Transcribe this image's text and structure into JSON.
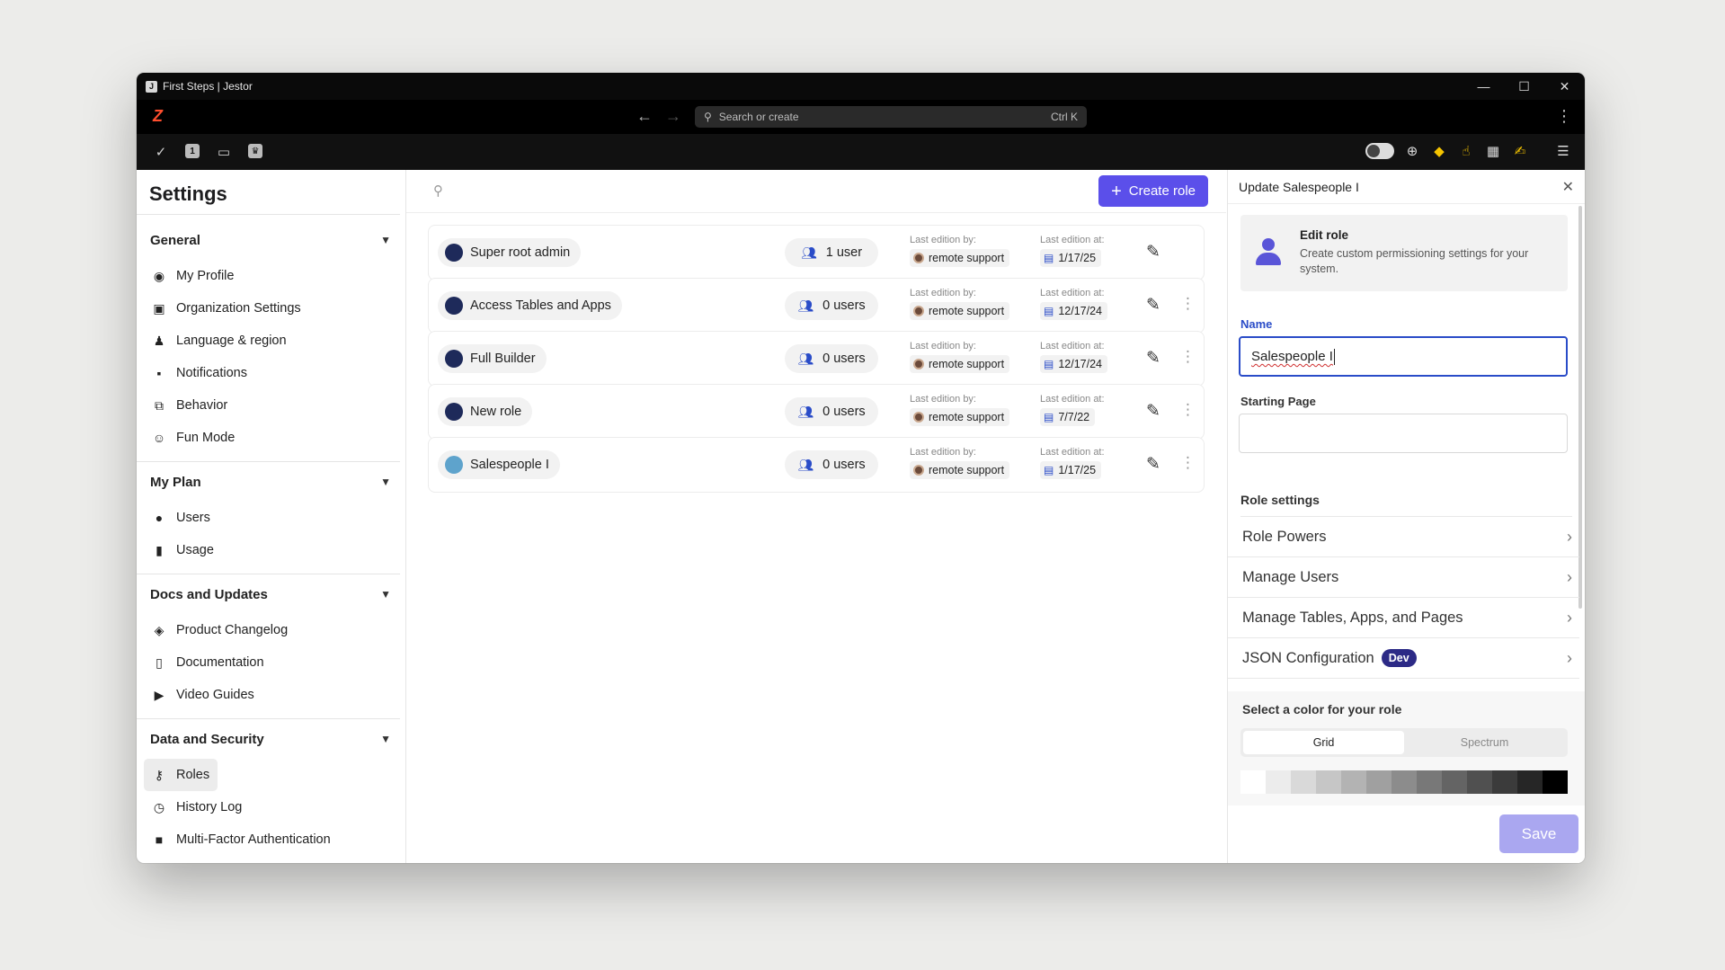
{
  "window": {
    "title": "First Steps | Jestor",
    "minimize": "—",
    "maximize": "☐",
    "close": "✕"
  },
  "navbar": {
    "logo": "Z",
    "back": "←",
    "forward": "→",
    "search_placeholder": "Search or create",
    "shortcut": "Ctrl K",
    "menu": "⋮"
  },
  "toolbar": {
    "left_icons": [
      "check-circle-icon",
      "number-icon",
      "chat-icon",
      "crown-icon"
    ],
    "badge_number": "1"
  },
  "sidebar": {
    "title": "Settings",
    "sections": [
      {
        "label": "General",
        "items": [
          {
            "label": "My Profile",
            "icon": "user-circle-icon",
            "glyph": "◉"
          },
          {
            "label": "Organization Settings",
            "icon": "id-card-icon",
            "glyph": "▣"
          },
          {
            "label": "Language & region",
            "icon": "person-pin-icon",
            "glyph": "♟"
          },
          {
            "label": "Notifications",
            "icon": "notification-icon",
            "glyph": "▪"
          },
          {
            "label": "Behavior",
            "icon": "behavior-icon",
            "glyph": "⧉"
          },
          {
            "label": "Fun Mode",
            "icon": "smile-icon",
            "glyph": "☺"
          }
        ]
      },
      {
        "label": "My Plan",
        "items": [
          {
            "label": "Users",
            "icon": "user-icon",
            "glyph": "●"
          },
          {
            "label": "Usage",
            "icon": "bar-chart-icon",
            "glyph": "▮"
          }
        ]
      },
      {
        "label": "Docs and Updates",
        "items": [
          {
            "label": "Product Changelog",
            "icon": "layers-icon",
            "glyph": "◈"
          },
          {
            "label": "Documentation",
            "icon": "document-icon",
            "glyph": "▯"
          },
          {
            "label": "Video Guides",
            "icon": "video-icon",
            "glyph": "▶"
          }
        ]
      },
      {
        "label": "Data and Security",
        "items": [
          {
            "label": "Roles",
            "icon": "key-icon",
            "glyph": "⚷"
          },
          {
            "label": "History Log",
            "icon": "clock-icon",
            "glyph": "◷"
          },
          {
            "label": "Multi-Factor Authentication",
            "icon": "lock-icon",
            "glyph": "■"
          }
        ]
      }
    ]
  },
  "main": {
    "create_button": "Create role",
    "last_edition_by_label": "Last edition by:",
    "last_edition_at_label": "Last edition at:",
    "roles": [
      {
        "name": "Super root admin",
        "users": "1 user",
        "by": "remote support",
        "at": "1/17/25",
        "color": "#1e2a5a"
      },
      {
        "name": "Access Tables and Apps",
        "users": "0 users",
        "by": "remote support",
        "at": "12/17/24",
        "color": "#1e2a5a"
      },
      {
        "name": "Full Builder",
        "users": "0 users",
        "by": "remote support",
        "at": "12/17/24",
        "color": "#1e2a5a"
      },
      {
        "name": "New role",
        "users": "0 users",
        "by": "remote support",
        "at": "7/7/22",
        "color": "#1e2a5a"
      },
      {
        "name": "Salespeople I",
        "users": "0 users",
        "by": "remote support",
        "at": "1/17/25",
        "color": "#5ea3cc"
      }
    ]
  },
  "panel": {
    "title": "Update Salespeople I",
    "card_title": "Edit role",
    "card_desc": "Create custom permissioning settings for your system.",
    "name_label": "Name",
    "name_value": "Salespeople I",
    "starting_page_label": "Starting Page",
    "starting_page_value": "",
    "role_settings_title": "Role settings",
    "settings": [
      {
        "label": "Role Powers"
      },
      {
        "label": "Manage Users"
      },
      {
        "label": "Manage Tables, Apps, and Pages"
      },
      {
        "label": "JSON Configuration",
        "badge": "Dev"
      }
    ],
    "color_title": "Select a color for your role",
    "color_tabs": [
      "Grid",
      "Spectrum"
    ],
    "active_color_tab": "Grid",
    "swatches": [
      "#ffffff",
      "#ececec",
      "#d9d9d9",
      "#c6c6c6",
      "#b3b3b3",
      "#a0a0a0",
      "#8c8c8c",
      "#787878",
      "#646464",
      "#505050",
      "#3b3b3b",
      "#262626",
      "#000000"
    ],
    "save": "Save"
  },
  "colors": {
    "accent": "#5b4fea",
    "link_blue": "#2a4cc8",
    "save_disabled": "#aaa7f0"
  }
}
